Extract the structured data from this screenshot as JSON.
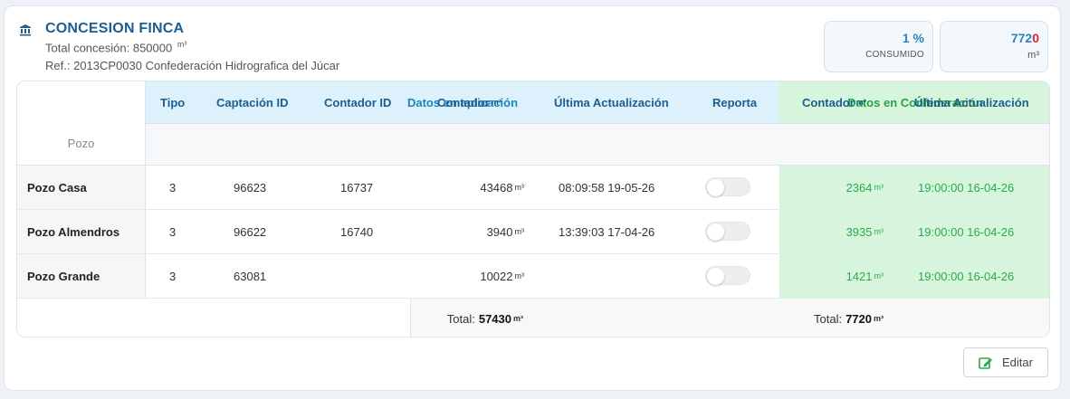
{
  "header": {
    "title": "CONCESION FINCA",
    "total_line": "Total concesión: 850000",
    "total_unit": "m³",
    "ref": "Ref.: 2013CP0030 Confederación Hidrografica del Júcar"
  },
  "stats": {
    "consumed": {
      "value": "1 %",
      "label": "CONSUMIDO"
    },
    "volume": {
      "value_main": "772",
      "value_red": "0",
      "unit": "m³"
    }
  },
  "colors": {
    "primary": "#1d5d8f",
    "app_accent": "#1a86bf",
    "conf_accent": "#27a346",
    "alert": "#dd2222"
  },
  "table": {
    "group_app": "Datos en aplicación",
    "group_conf": "Datos en Confederación",
    "col_pozo": "Pozo",
    "col_tipo": "Tipo",
    "col_captacion": "Captación ID",
    "col_contador_id": "Contador ID",
    "col_contador": "Contador",
    "col_unit": "m³",
    "col_ultima": "Última Actualización",
    "col_reporta": "Reporta",
    "col_conf_contador": "Contador",
    "col_conf_ultima": "Última Actualización",
    "rows": [
      {
        "pozo": "Pozo Casa",
        "tipo": "3",
        "captacion": "96623",
        "contador_id": "16737",
        "contador": "43468",
        "ultima": "08:09:58 19-05-26",
        "reporta": false,
        "conf_contador": "2364",
        "conf_ultima": "19:00:00 16-04-26"
      },
      {
        "pozo": "Pozo Almendros",
        "tipo": "3",
        "captacion": "96622",
        "contador_id": "16740",
        "contador": "3940",
        "ultima": "13:39:03 17-04-26",
        "reporta": false,
        "conf_contador": "3935",
        "conf_ultima": "19:00:00 16-04-26"
      },
      {
        "pozo": "Pozo Grande",
        "tipo": "3",
        "captacion": "63081",
        "contador_id": "",
        "contador": "10022",
        "ultima": "",
        "reporta": false,
        "conf_contador": "1421",
        "conf_ultima": "19:00:00 16-04-26"
      }
    ],
    "total_label": "Total:",
    "total_app": "57430",
    "total_conf": "7720"
  },
  "actions": {
    "edit_label": "Editar"
  }
}
